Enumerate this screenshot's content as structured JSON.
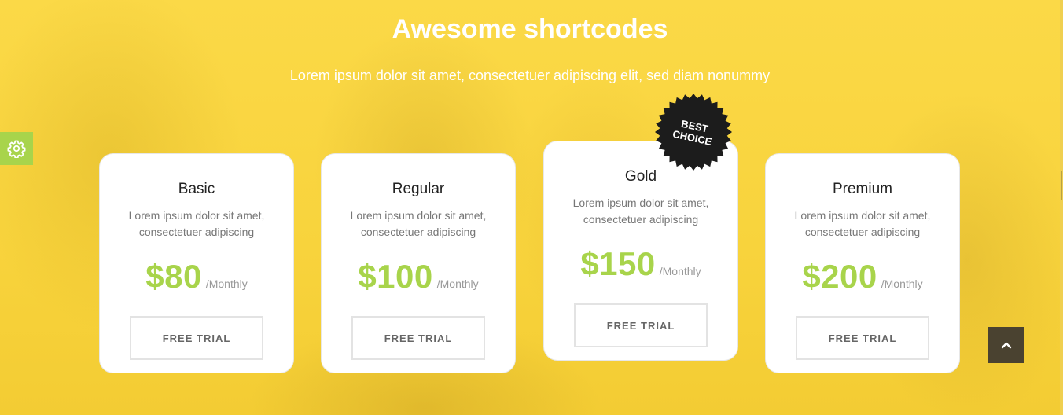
{
  "section": {
    "title": "Awesome shortcodes",
    "subtitle": "Lorem ipsum dolor sit amet, consectetuer adipiscing elit, sed diam nonummy"
  },
  "colors": {
    "background": "#f9d43c",
    "accent": "#a8d44b",
    "badge": "#1c1c1c",
    "scroll_button": "#4a4230"
  },
  "icons": {
    "settings": "gear-icon",
    "scroll_top": "chevron-up-icon"
  },
  "plans": [
    {
      "name": "Basic",
      "description": "Lorem ipsum dolor sit amet, consectetuer adipiscing",
      "price": "$80",
      "period": "/Monthly",
      "button": "FREE TRIAL"
    },
    {
      "name": "Regular",
      "description": "Lorem ipsum dolor sit amet, consectetuer adipiscing",
      "price": "$100",
      "period": "/Monthly",
      "button": "FREE TRIAL"
    },
    {
      "name": "Gold",
      "description": "Lorem ipsum dolor sit amet, consectetuer adipiscing",
      "price": "$150",
      "period": "/Monthly",
      "button": "FREE TRIAL"
    },
    {
      "name": "Premium",
      "description": "Lorem ipsum dolor sit amet, consectetuer adipiscing",
      "price": "$200",
      "period": "/Monthly",
      "button": "FREE TRIAL"
    }
  ],
  "badge": {
    "line1": "BEST",
    "line2": "CHOICE"
  }
}
